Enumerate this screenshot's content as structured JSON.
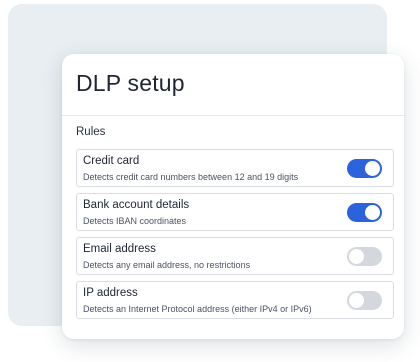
{
  "card": {
    "title": "DLP setup",
    "section_label": "Rules"
  },
  "rules": [
    {
      "name": "Credit card",
      "description": "Detects credit card numbers between 12 and 19 digits",
      "enabled": true
    },
    {
      "name": "Bank account details",
      "description": "Detects IBAN coordinates",
      "enabled": true
    },
    {
      "name": "Email address",
      "description": "Detects any email address, no restrictions",
      "enabled": false
    },
    {
      "name": "IP address",
      "description": "Detects an Internet Protocol address (either IPv4 or IPv6)",
      "enabled": false
    }
  ],
  "colors": {
    "toggle_on": "#2d62dd",
    "toggle_off": "#d5d7de",
    "background_panel": "#e8eef1"
  }
}
